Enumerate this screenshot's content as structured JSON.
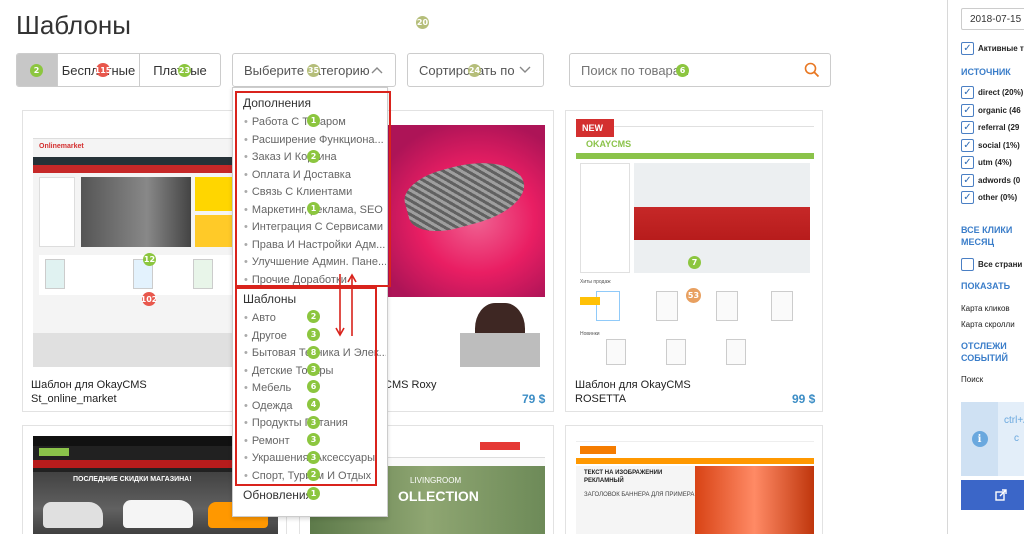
{
  "page_title": "Шаблоны",
  "filters": {
    "free_label": "Бесплатные",
    "paid_label": "Платные",
    "category_placeholder": "Выберите категорию",
    "sort_label": "Сортировать по",
    "search_placeholder": "Поиск по товарам"
  },
  "dropdown": {
    "group1": {
      "title": "Дополнения",
      "items": [
        "Работа С Товаром",
        "Расширение Функциона...",
        "Заказ И Корзина",
        "Оплата И Доставка",
        "Связь С Клиентами",
        "Маркетинг, реклама, SEO",
        "Интеграция С Сервисами",
        "Права И Настройки Адм...",
        "Улучшение Админ. Пане...",
        "Прочие Доработки"
      ]
    },
    "group2": {
      "title": "Шаблоны",
      "items": [
        "Авто",
        "Другое",
        "Бытовая Техника И Элек...",
        "Детские Товары",
        "Мебель",
        "Одежда",
        "Продукты Питания",
        "Ремонт",
        "Украшения, Аксессуары",
        "Спорт, Туризм И Отдых"
      ]
    },
    "group3": {
      "title": "Обновления"
    }
  },
  "cards": [
    {
      "title_line1": "Шаблон для OkayCMS",
      "title_line2": "St_online_market",
      "price": "",
      "thumb_text": "Onlinemarket"
    },
    {
      "title_line1": "CMS Roxy",
      "title_line2": "",
      "price": "79 $"
    },
    {
      "title_line1": "Шаблон для OkayCMS",
      "title_line2": "ROSETTA",
      "price": "99 $",
      "thumb_logo": "OKAYCMS",
      "thumb_new": "NEW",
      "thumb_hits": "Хиты продаж",
      "thumb_news": "Новинки"
    },
    {
      "thumb_text": "ПОСЛЕДНИЕ СКИДКИ МАГАЗИНА!"
    },
    {
      "thumb_text1": "LIVINGROOM",
      "thumb_text2": "OLLECTION"
    },
    {
      "thumb_text1": "ТЕКСТ НА ИЗОБРАЖЕНИИ",
      "thumb_text2": "РЕКЛАМНЫЙ",
      "thumb_text3": "ЗАГОЛОВОК БАННЕРА ДЛЯ ПРИМЕРА"
    }
  ],
  "badges": {
    "b_title": "20",
    "b_free_active": "2",
    "b_free": "115",
    "b_paid": "23",
    "b_cat": "35",
    "b_sort": "24",
    "b_search": "6",
    "b_card1_a": "12",
    "b_card1_b": "102",
    "b_card3_a": "53",
    "b_card3_b": "7",
    "dd1": "1",
    "dd3": "2",
    "dd6": "1",
    "dd2_1": "2",
    "dd2_2": "3",
    "dd2_3": "8",
    "dd2_4": "3",
    "dd2_5": "6",
    "dd2_6": "4",
    "dd2_7": "3",
    "dd2_8": "3",
    "dd2_9": "3",
    "dd2_10": "2",
    "dd3_title": "1"
  },
  "right_panel": {
    "date": "2018-07-15",
    "active_label": "Активные то",
    "sources_title": "ИСТОЧНИК",
    "sources": [
      "direct (20%)",
      "organic (46",
      "referral (29",
      "social (1%)",
      "utm (4%)",
      "adwords (0",
      "other (0%)"
    ],
    "clicks_title_1": "ВСЕ КЛИКИ",
    "clicks_title_2": "МЕСЯЦ",
    "all_pages_label": "Все страни",
    "show_title": "ПОКАЗАТЬ",
    "click_map": "Карта кликов",
    "scroll_map": "Карта скролли",
    "track_title_1": "ОТСЛЕЖИ",
    "track_title_2": "СОБЫТИЙ",
    "search_label": "Поиск",
    "info_line1": "ctrl+A",
    "info_line2": "c"
  }
}
